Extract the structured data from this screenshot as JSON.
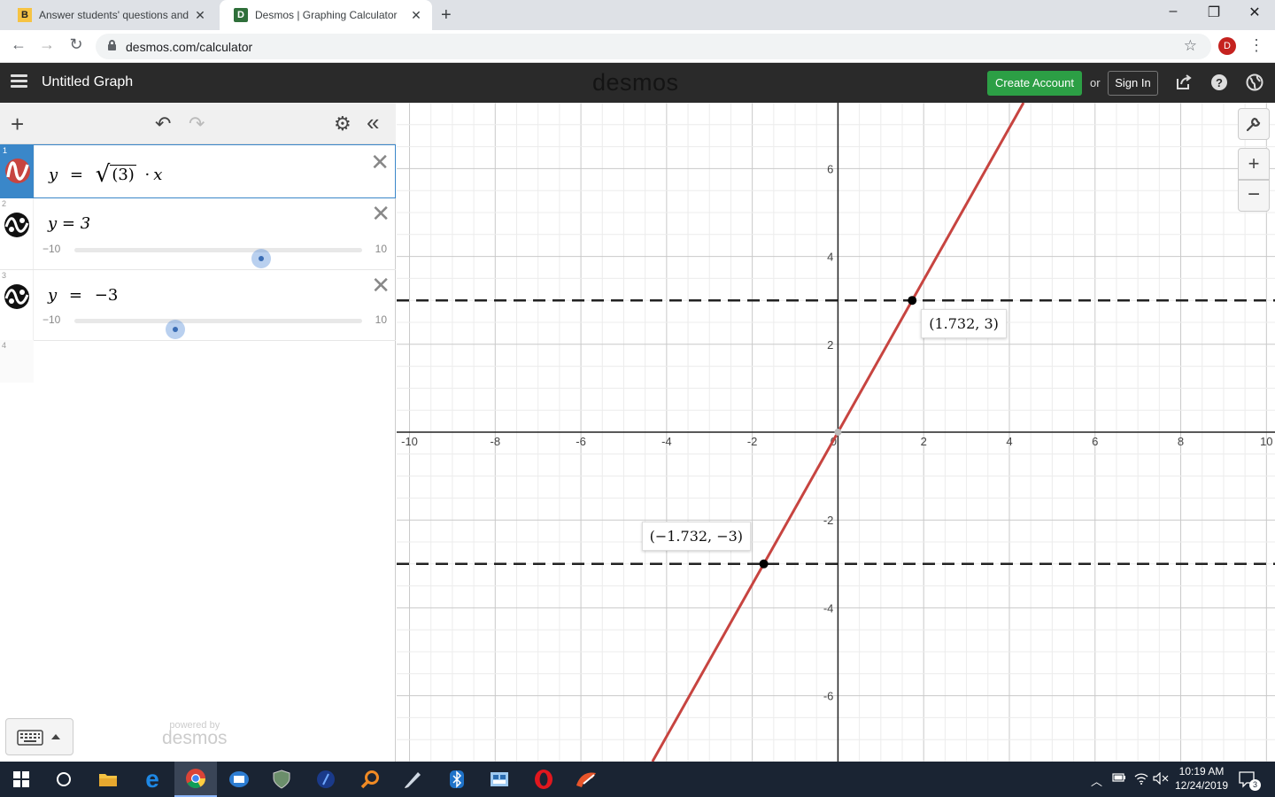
{
  "browser": {
    "tabs": [
      {
        "title": "Answer students' questions and l",
        "favicon": "brainly-icon"
      },
      {
        "title": "Desmos | Graphing Calculator",
        "favicon": "desmos-icon"
      }
    ],
    "url": "desmos.com/calculator",
    "profile_initial": "D"
  },
  "header": {
    "title": "Untitled Graph",
    "wordmark": "desmos",
    "create_account": "Create Account",
    "or": "or",
    "sign_in": "Sign In"
  },
  "expressions": [
    {
      "number": "1",
      "active": true,
      "color": "#c74440"
    },
    {
      "number": "2",
      "latex_text": "y = 3",
      "slider": {
        "min": "−10",
        "max": "10",
        "value": 3
      }
    },
    {
      "number": "3",
      "latex_text": "y = −3",
      "slider": {
        "min": "−10",
        "max": "10",
        "value": -3
      }
    },
    {
      "number": "4"
    }
  ],
  "expr1": {
    "y": "y",
    "eq": "=",
    "radicand": "(3)",
    "dot": "·",
    "x": "x"
  },
  "expr3": {
    "y": "y",
    "eq": "=",
    "rhs": "−3"
  },
  "panel": {
    "powered_by": "powered by",
    "brand": "desmos"
  },
  "graph": {
    "xlim": [
      -10.3,
      10.2
    ],
    "ylim": [
      -7.5,
      7.5
    ],
    "x_ticks": [
      "-10",
      "-8",
      "-6",
      "-4",
      "-2",
      "0",
      "2",
      "4",
      "6",
      "8",
      "10"
    ],
    "y_ticks": [
      "6",
      "4",
      "2",
      "-2",
      "-4",
      "-6"
    ],
    "line_slope": 1.732,
    "line_color": "#c74440",
    "dashed_lines": [
      3,
      -3
    ],
    "points": [
      {
        "x": 1.732,
        "y": 3,
        "label": "(1.732, 3)"
      },
      {
        "x": -1.732,
        "y": -3,
        "label": "(−1.732, −3)"
      }
    ]
  },
  "taskbar": {
    "time": "10:19 AM",
    "date": "12/24/2019",
    "notifications": "3"
  }
}
